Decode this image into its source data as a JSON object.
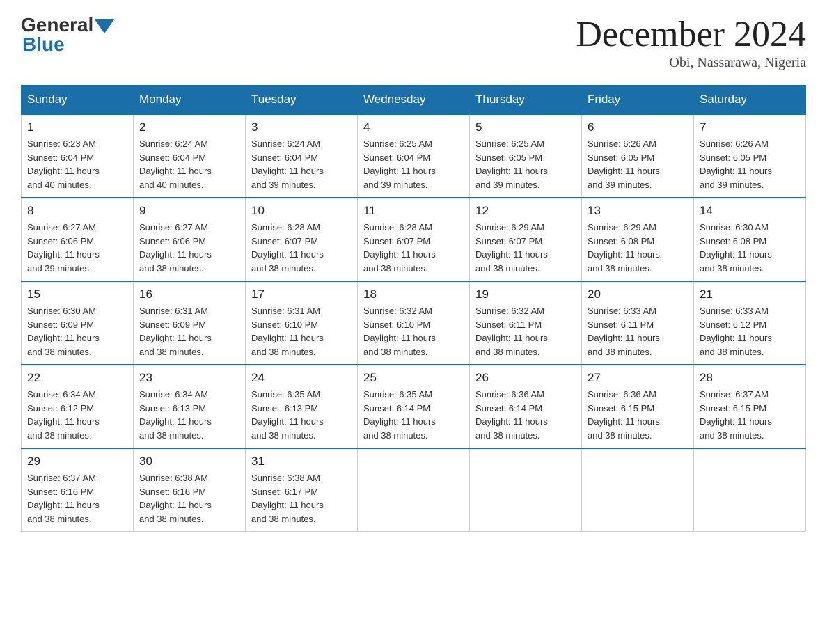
{
  "header": {
    "logo": {
      "general": "General",
      "blue": "Blue"
    },
    "title": "December 2024",
    "location": "Obi, Nassarawa, Nigeria"
  },
  "days_of_week": [
    "Sunday",
    "Monday",
    "Tuesday",
    "Wednesday",
    "Thursday",
    "Friday",
    "Saturday"
  ],
  "weeks": [
    [
      {
        "day": "1",
        "sunrise": "6:23 AM",
        "sunset": "6:04 PM",
        "daylight": "11 hours and 40 minutes."
      },
      {
        "day": "2",
        "sunrise": "6:24 AM",
        "sunset": "6:04 PM",
        "daylight": "11 hours and 40 minutes."
      },
      {
        "day": "3",
        "sunrise": "6:24 AM",
        "sunset": "6:04 PM",
        "daylight": "11 hours and 39 minutes."
      },
      {
        "day": "4",
        "sunrise": "6:25 AM",
        "sunset": "6:04 PM",
        "daylight": "11 hours and 39 minutes."
      },
      {
        "day": "5",
        "sunrise": "6:25 AM",
        "sunset": "6:05 PM",
        "daylight": "11 hours and 39 minutes."
      },
      {
        "day": "6",
        "sunrise": "6:26 AM",
        "sunset": "6:05 PM",
        "daylight": "11 hours and 39 minutes."
      },
      {
        "day": "7",
        "sunrise": "6:26 AM",
        "sunset": "6:05 PM",
        "daylight": "11 hours and 39 minutes."
      }
    ],
    [
      {
        "day": "8",
        "sunrise": "6:27 AM",
        "sunset": "6:06 PM",
        "daylight": "11 hours and 39 minutes."
      },
      {
        "day": "9",
        "sunrise": "6:27 AM",
        "sunset": "6:06 PM",
        "daylight": "11 hours and 38 minutes."
      },
      {
        "day": "10",
        "sunrise": "6:28 AM",
        "sunset": "6:07 PM",
        "daylight": "11 hours and 38 minutes."
      },
      {
        "day": "11",
        "sunrise": "6:28 AM",
        "sunset": "6:07 PM",
        "daylight": "11 hours and 38 minutes."
      },
      {
        "day": "12",
        "sunrise": "6:29 AM",
        "sunset": "6:07 PM",
        "daylight": "11 hours and 38 minutes."
      },
      {
        "day": "13",
        "sunrise": "6:29 AM",
        "sunset": "6:08 PM",
        "daylight": "11 hours and 38 minutes."
      },
      {
        "day": "14",
        "sunrise": "6:30 AM",
        "sunset": "6:08 PM",
        "daylight": "11 hours and 38 minutes."
      }
    ],
    [
      {
        "day": "15",
        "sunrise": "6:30 AM",
        "sunset": "6:09 PM",
        "daylight": "11 hours and 38 minutes."
      },
      {
        "day": "16",
        "sunrise": "6:31 AM",
        "sunset": "6:09 PM",
        "daylight": "11 hours and 38 minutes."
      },
      {
        "day": "17",
        "sunrise": "6:31 AM",
        "sunset": "6:10 PM",
        "daylight": "11 hours and 38 minutes."
      },
      {
        "day": "18",
        "sunrise": "6:32 AM",
        "sunset": "6:10 PM",
        "daylight": "11 hours and 38 minutes."
      },
      {
        "day": "19",
        "sunrise": "6:32 AM",
        "sunset": "6:11 PM",
        "daylight": "11 hours and 38 minutes."
      },
      {
        "day": "20",
        "sunrise": "6:33 AM",
        "sunset": "6:11 PM",
        "daylight": "11 hours and 38 minutes."
      },
      {
        "day": "21",
        "sunrise": "6:33 AM",
        "sunset": "6:12 PM",
        "daylight": "11 hours and 38 minutes."
      }
    ],
    [
      {
        "day": "22",
        "sunrise": "6:34 AM",
        "sunset": "6:12 PM",
        "daylight": "11 hours and 38 minutes."
      },
      {
        "day": "23",
        "sunrise": "6:34 AM",
        "sunset": "6:13 PM",
        "daylight": "11 hours and 38 minutes."
      },
      {
        "day": "24",
        "sunrise": "6:35 AM",
        "sunset": "6:13 PM",
        "daylight": "11 hours and 38 minutes."
      },
      {
        "day": "25",
        "sunrise": "6:35 AM",
        "sunset": "6:14 PM",
        "daylight": "11 hours and 38 minutes."
      },
      {
        "day": "26",
        "sunrise": "6:36 AM",
        "sunset": "6:14 PM",
        "daylight": "11 hours and 38 minutes."
      },
      {
        "day": "27",
        "sunrise": "6:36 AM",
        "sunset": "6:15 PM",
        "daylight": "11 hours and 38 minutes."
      },
      {
        "day": "28",
        "sunrise": "6:37 AM",
        "sunset": "6:15 PM",
        "daylight": "11 hours and 38 minutes."
      }
    ],
    [
      {
        "day": "29",
        "sunrise": "6:37 AM",
        "sunset": "6:16 PM",
        "daylight": "11 hours and 38 minutes."
      },
      {
        "day": "30",
        "sunrise": "6:38 AM",
        "sunset": "6:16 PM",
        "daylight": "11 hours and 38 minutes."
      },
      {
        "day": "31",
        "sunrise": "6:38 AM",
        "sunset": "6:17 PM",
        "daylight": "11 hours and 38 minutes."
      },
      null,
      null,
      null,
      null
    ]
  ],
  "labels": {
    "sunrise": "Sunrise:",
    "sunset": "Sunset:",
    "daylight": "Daylight:"
  }
}
